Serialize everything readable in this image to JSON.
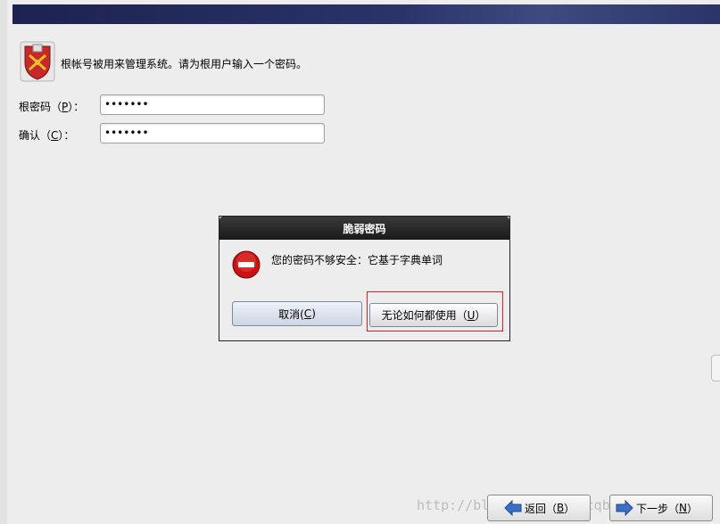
{
  "intro": {
    "text": "根帐号被用来管理系统。请为根用户输入一个密码。"
  },
  "form": {
    "root_password": {
      "label_prefix": "根密码（",
      "mnemonic": "P",
      "label_suffix": "）：",
      "value": "•••••••"
    },
    "confirm": {
      "label_prefix": "确认（",
      "mnemonic": "C",
      "label_suffix": "）：",
      "value": "•••••••"
    }
  },
  "dialog": {
    "title": "脆弱密码",
    "message": "您的密码不够安全：它基于字典单词",
    "cancel": {
      "prefix": "取消(",
      "mnemonic": "C",
      "suffix": ")"
    },
    "use_anyway": {
      "prefix": "无论如何都使用（",
      "mnemonic": "U",
      "suffix": "）"
    }
  },
  "nav": {
    "back": {
      "prefix": "返回（",
      "mnemonic": "B",
      "suffix": "）"
    },
    "next": {
      "prefix": "下一步（",
      "mnemonic": "N",
      "suffix": "）"
    }
  },
  "watermark": "http://blog.csdn.net/cqbzl...4",
  "colors": {
    "banner": "#1c2350",
    "highlight_border": "#e02020",
    "error_icon": "#cc1111"
  }
}
